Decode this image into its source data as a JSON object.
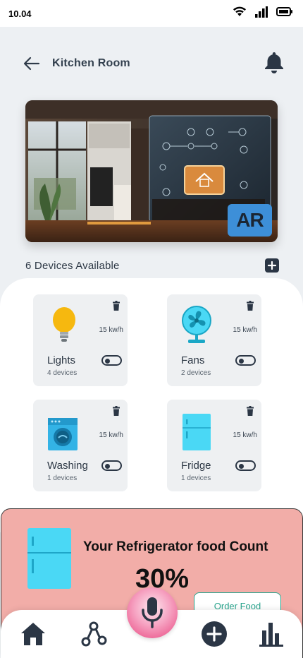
{
  "status_bar": {
    "time": "10.04"
  },
  "header": {
    "title": "Kitchen Room"
  },
  "hero": {
    "ar_label": "AR"
  },
  "devices_section": {
    "title": "6 Devices Available"
  },
  "devices": [
    {
      "name": "Lights",
      "count": "4 devices",
      "power": "15 kw/h",
      "icon": "bulb-icon",
      "on": false
    },
    {
      "name": "Fans",
      "count": "2 devices",
      "power": "15 kw/h",
      "icon": "fan-icon",
      "on": false
    },
    {
      "name": "Washing",
      "count": "1 devices",
      "power": "15 kw/h",
      "icon": "washing-machine-icon",
      "on": false
    },
    {
      "name": "Fridge",
      "count": "1 devices",
      "power": "15 kw/h",
      "icon": "fridge-icon",
      "on": false
    }
  ],
  "banner": {
    "title": "Your Refrigerator food Count",
    "percent": "30%",
    "order_label": "Order Food"
  },
  "nav": {
    "items": [
      "home-icon",
      "share-nodes-icon",
      "add-circle-icon",
      "bar-chart-icon"
    ],
    "center": "microphone-icon"
  },
  "colors": {
    "background": "#edf0f3",
    "dark": "#2b3645",
    "ar_badge": "#3d8fd8",
    "banner": "#f2ada8",
    "accent_green": "#2aa58e",
    "cyan": "#4ad8f5",
    "bulb": "#f6b80f"
  }
}
